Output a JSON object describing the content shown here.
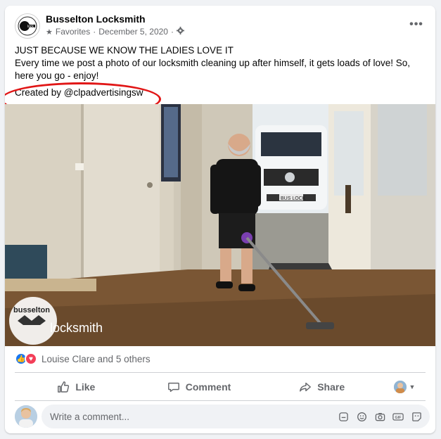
{
  "post": {
    "page_name": "Busselton Locksmith",
    "audience_label": "Favorites",
    "separator": "·",
    "date": "December 5, 2020",
    "more_label": "•••",
    "text_line1": "JUST BECAUSE WE KNOW THE LADIES LOVE IT",
    "text_line2": "Every time we post a photo of our locksmith cleaning up after himself, it gets loads of love! So, here you go - enjoy!",
    "credit": "Created by @clpadvertisingsw",
    "photo_logo_top": "busselton",
    "photo_logo_bottom": "locksmith",
    "van_plate": "BUS LOCK"
  },
  "reactions": {
    "summary": "Louise Clare and 5 others"
  },
  "actions": {
    "like": "Like",
    "comment": "Comment",
    "share": "Share"
  },
  "comment": {
    "placeholder": "Write a comment..."
  },
  "colors": {
    "accent": "#1877f2",
    "love": "#f33e58",
    "annotation": "#e11616"
  },
  "icons": [
    "globe-icon",
    "more-icon",
    "like-reaction-icon",
    "love-reaction-icon",
    "thumbs-up-icon",
    "comment-icon",
    "share-icon",
    "chevron-down-icon",
    "sticker-icon",
    "emoji-icon",
    "camera-icon",
    "gif-icon",
    "smile-sticker-icon"
  ]
}
